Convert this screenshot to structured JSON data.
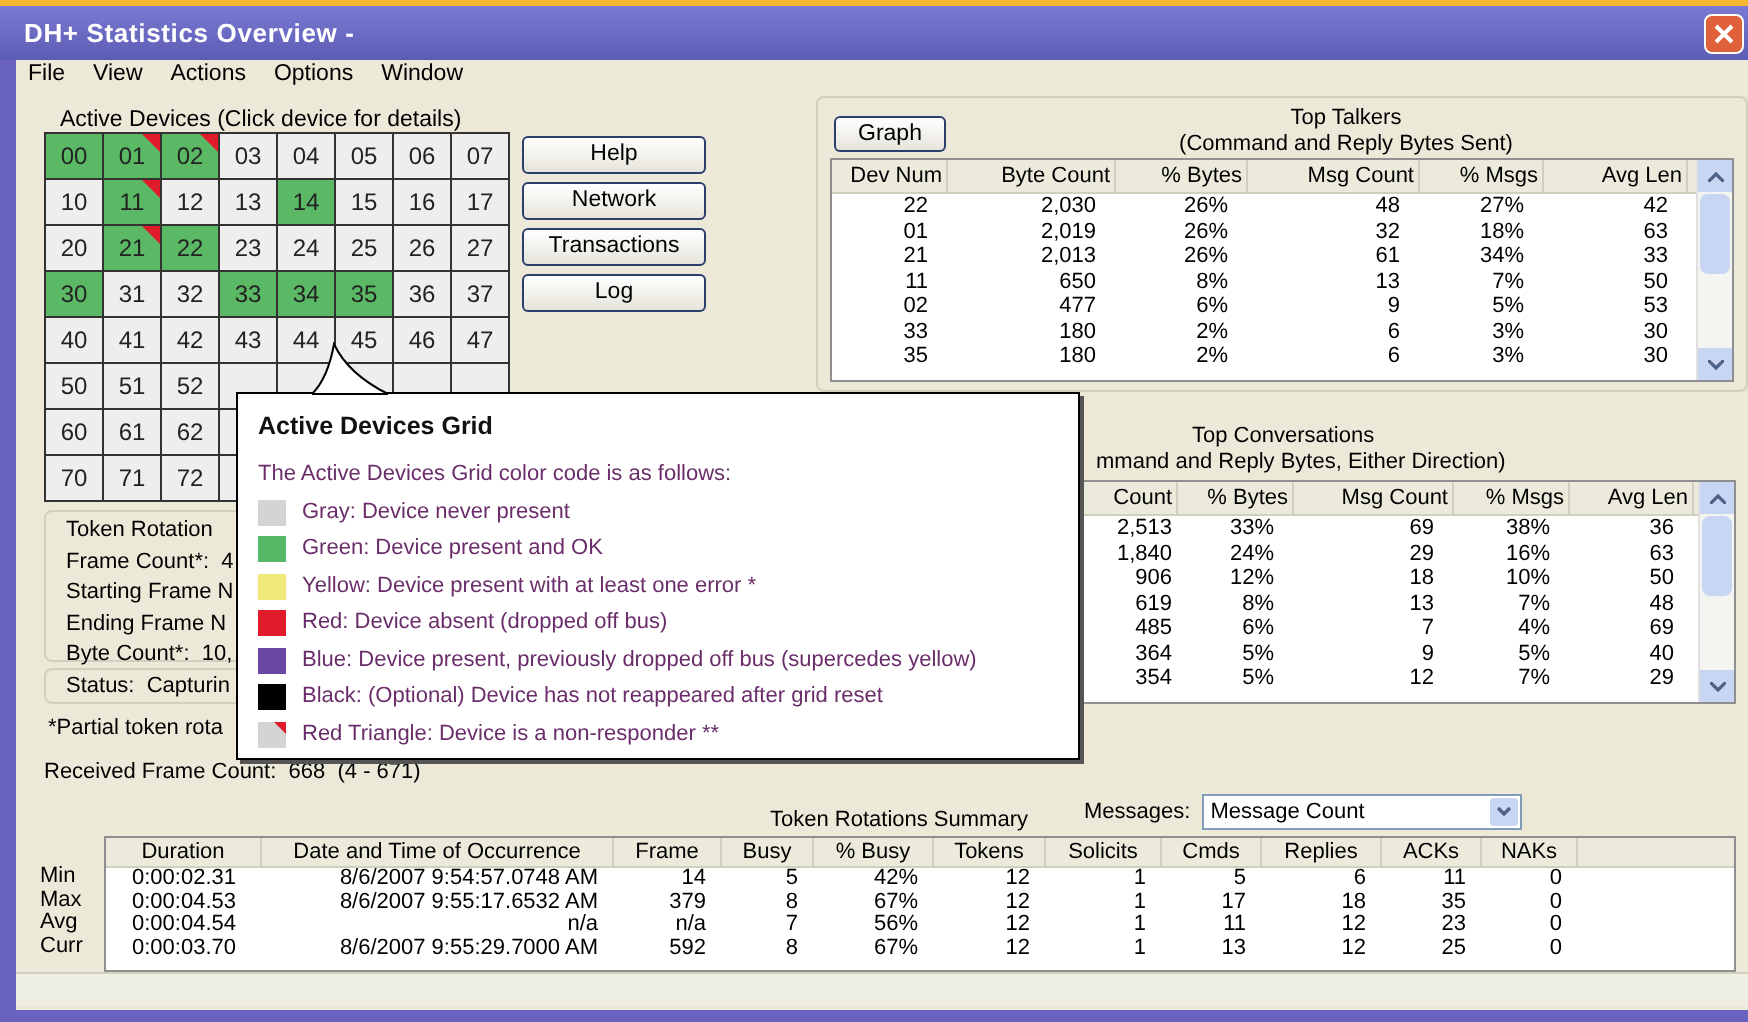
{
  "window": {
    "title": "DH+ Statistics Overview -"
  },
  "menu": [
    "File",
    "View",
    "Actions",
    "Options",
    "Window"
  ],
  "devices": {
    "title": "Active Devices (Click device for details)",
    "rows": [
      [
        {
          "label": "00",
          "color": "#5bb865",
          "non_responder": false
        },
        {
          "label": "01",
          "color": "#5bb865",
          "non_responder": true
        },
        {
          "label": "02",
          "color": "#5bb865",
          "non_responder": true
        },
        {
          "label": "03",
          "color": "#eeeeee",
          "non_responder": false
        },
        {
          "label": "04",
          "color": "#eeeeee",
          "non_responder": false
        },
        {
          "label": "05",
          "color": "#eeeeee",
          "non_responder": false
        },
        {
          "label": "06",
          "color": "#eeeeee",
          "non_responder": false
        },
        {
          "label": "07",
          "color": "#eeeeee",
          "non_responder": false
        }
      ],
      [
        {
          "label": "10",
          "color": "#eeeeee",
          "non_responder": false
        },
        {
          "label": "11",
          "color": "#5bb865",
          "non_responder": true
        },
        {
          "label": "12",
          "color": "#eeeeee",
          "non_responder": false
        },
        {
          "label": "13",
          "color": "#eeeeee",
          "non_responder": false
        },
        {
          "label": "14",
          "color": "#5bb865",
          "non_responder": false
        },
        {
          "label": "15",
          "color": "#eeeeee",
          "non_responder": false
        },
        {
          "label": "16",
          "color": "#eeeeee",
          "non_responder": false
        },
        {
          "label": "17",
          "color": "#eeeeee",
          "non_responder": false
        }
      ],
      [
        {
          "label": "20",
          "color": "#eeeeee",
          "non_responder": false
        },
        {
          "label": "21",
          "color": "#5bb865",
          "non_responder": true
        },
        {
          "label": "22",
          "color": "#5bb865",
          "non_responder": false
        },
        {
          "label": "23",
          "color": "#eeeeee",
          "non_responder": false
        },
        {
          "label": "24",
          "color": "#eeeeee",
          "non_responder": false
        },
        {
          "label": "25",
          "color": "#eeeeee",
          "non_responder": false
        },
        {
          "label": "26",
          "color": "#eeeeee",
          "non_responder": false
        },
        {
          "label": "27",
          "color": "#eeeeee",
          "non_responder": false
        }
      ],
      [
        {
          "label": "30",
          "color": "#5bb865",
          "non_responder": false
        },
        {
          "label": "31",
          "color": "#eeeeee",
          "non_responder": false
        },
        {
          "label": "32",
          "color": "#eeeeee",
          "non_responder": false
        },
        {
          "label": "33",
          "color": "#5bb865",
          "non_responder": false
        },
        {
          "label": "34",
          "color": "#5bb865",
          "non_responder": false
        },
        {
          "label": "35",
          "color": "#5bb865",
          "non_responder": false
        },
        {
          "label": "36",
          "color": "#eeeeee",
          "non_responder": false
        },
        {
          "label": "37",
          "color": "#eeeeee",
          "non_responder": false
        }
      ],
      [
        {
          "label": "40",
          "color": "#eeeeee",
          "non_responder": false
        },
        {
          "label": "41",
          "color": "#eeeeee",
          "non_responder": false
        },
        {
          "label": "42",
          "color": "#eeeeee",
          "non_responder": false
        },
        {
          "label": "43",
          "color": "#eeeeee",
          "non_responder": false
        },
        {
          "label": "44",
          "color": "#eeeeee",
          "non_responder": false
        },
        {
          "label": "45",
          "color": "#eeeeee",
          "non_responder": false
        },
        {
          "label": "46",
          "color": "#eeeeee",
          "non_responder": false
        },
        {
          "label": "47",
          "color": "#eeeeee",
          "non_responder": false
        }
      ],
      [
        {
          "label": "50",
          "color": "#eeeeee",
          "non_responder": false
        },
        {
          "label": "51",
          "color": "#eeeeee",
          "non_responder": false
        },
        {
          "label": "52",
          "color": "#eeeeee",
          "non_responder": false
        }
      ],
      [
        {
          "label": "60",
          "color": "#eeeeee",
          "non_responder": false
        },
        {
          "label": "61",
          "color": "#eeeeee",
          "non_responder": false
        },
        {
          "label": "62",
          "color": "#eeeeee",
          "non_responder": false
        }
      ],
      [
        {
          "label": "70",
          "color": "#eeeeee",
          "non_responder": false
        },
        {
          "label": "71",
          "color": "#eeeeee",
          "non_responder": false
        },
        {
          "label": "72",
          "color": "#eeeeee",
          "non_responder": false
        }
      ]
    ]
  },
  "buttons": [
    "Help",
    "Network",
    "Transactions",
    "Log"
  ],
  "token_info": [
    "Token Rotation",
    "Frame Count*:  4",
    "Starting Frame N",
    "Ending Frame N",
    "Byte Count*:  10,"
  ],
  "status": "Status:  Capturin",
  "note": "*Partial token rota",
  "received": "Received Frame Count:  668  (4 - 671)",
  "top_talkers": {
    "button": "Graph",
    "title": "Top Talkers",
    "subtitle": "(Command and Reply Bytes Sent)",
    "columns": [
      "Dev Num",
      "Byte Count",
      "% Bytes",
      "Msg Count",
      "% Msgs",
      "Avg Len"
    ],
    "rows": [
      [
        "22",
        "2,030",
        "26%",
        "48",
        "27%",
        "42"
      ],
      [
        "01",
        "2,019",
        "26%",
        "32",
        "18%",
        "63"
      ],
      [
        "21",
        "2,013",
        "26%",
        "61",
        "34%",
        "33"
      ],
      [
        "11",
        "650",
        "8%",
        "13",
        "7%",
        "50"
      ],
      [
        "02",
        "477",
        "6%",
        "9",
        "5%",
        "53"
      ],
      [
        "33",
        "180",
        "2%",
        "6",
        "3%",
        "30"
      ],
      [
        "35",
        "180",
        "2%",
        "6",
        "3%",
        "30"
      ]
    ]
  },
  "top_conversations": {
    "title": "Top Conversations",
    "subtitle": "mmand and Reply Bytes, Either Direction)",
    "columns": [
      "Count",
      "% Bytes",
      "Msg Count",
      "% Msgs",
      "Avg Len"
    ],
    "rows": [
      [
        "2,513",
        "33%",
        "69",
        "38%",
        "36"
      ],
      [
        "1,840",
        "24%",
        "29",
        "16%",
        "63"
      ],
      [
        "906",
        "12%",
        "18",
        "10%",
        "50"
      ],
      [
        "619",
        "8%",
        "13",
        "7%",
        "48"
      ],
      [
        "485",
        "6%",
        "7",
        "4%",
        "69"
      ],
      [
        "364",
        "5%",
        "9",
        "5%",
        "40"
      ],
      [
        "354",
        "5%",
        "12",
        "7%",
        "29"
      ]
    ]
  },
  "tooltip": {
    "title": "Active Devices Grid",
    "intro": "The Active Devices Grid color code is as follows:",
    "items": [
      {
        "kind": "swatch",
        "color": "#d4d4d4",
        "text": "Gray: Device never present"
      },
      {
        "kind": "swatch",
        "color": "#56b866",
        "text": "Green: Device present and OK"
      },
      {
        "kind": "swatch",
        "color": "#f0ea7a",
        "text": "Yellow: Device present with at least one error *"
      },
      {
        "kind": "swatch",
        "color": "#e01c2a",
        "text": "Red: Device absent (dropped off bus)"
      },
      {
        "kind": "swatch",
        "color": "#6a48a4",
        "text": "Blue: Device present, previously dropped off bus (supercedes yellow)"
      },
      {
        "kind": "swatch",
        "color": "#000000",
        "text": "Black: (Optional) Device has not reappeared after grid reset"
      },
      {
        "kind": "triangle",
        "color": "#d4d4d4",
        "text": "Red Triangle: Device is a non-responder **"
      }
    ]
  },
  "summary": {
    "title": "Token Rotations Summary",
    "messages_label": "Messages:",
    "messages_value": "Message Count",
    "columns": [
      "Duration",
      "Date and Time of Occurrence",
      "Frame",
      "Busy",
      "% Busy",
      "Tokens",
      "Solicits",
      "Cmds",
      "Replies",
      "ACKs",
      "NAKs"
    ],
    "rows": [
      {
        "label": "Min",
        "cells": [
          "0:00:02.31",
          "8/6/2007 9:54:57.0748 AM",
          "14",
          "5",
          "42%",
          "12",
          "1",
          "5",
          "6",
          "11",
          "0"
        ]
      },
      {
        "label": "Max",
        "cells": [
          "0:00:04.53",
          "8/6/2007 9:55:17.6532 AM",
          "379",
          "8",
          "67%",
          "12",
          "1",
          "17",
          "18",
          "35",
          "0"
        ]
      },
      {
        "label": "Avg",
        "cells": [
          "0:00:04.54",
          "n/a",
          "n/a",
          "7",
          "56%",
          "12",
          "1",
          "11",
          "12",
          "23",
          "0"
        ]
      },
      {
        "label": "Curr",
        "cells": [
          "0:00:03.70",
          "8/6/2007 9:55:29.7000 AM",
          "592",
          "8",
          "67%",
          "12",
          "1",
          "13",
          "12",
          "25",
          "0"
        ]
      }
    ]
  }
}
